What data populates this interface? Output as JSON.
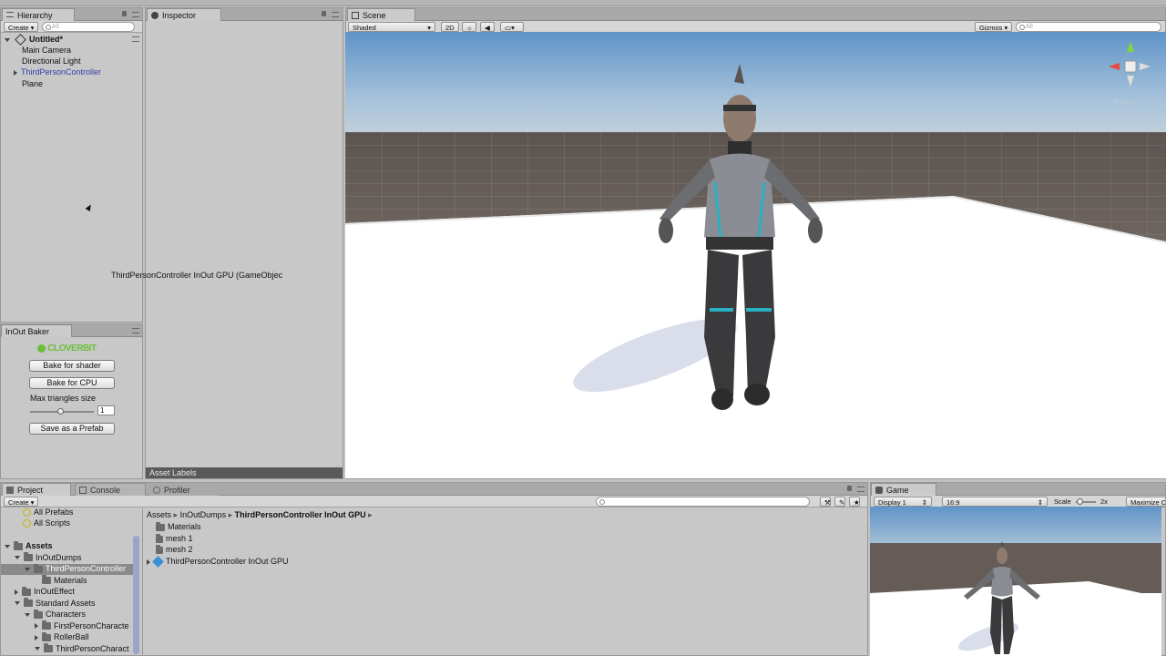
{
  "hierarchy": {
    "tab": "Hierarchy",
    "create_label": "Create",
    "search_placeholder": "All",
    "scene_name": "Untitled*",
    "items": [
      "Main Camera",
      "Directional Light",
      "ThirdPersonController",
      "Plane"
    ]
  },
  "inspector": {
    "tab": "Inspector",
    "drag_label": "ThirdPersonController InOut GPU (GameObjec",
    "asset_labels": "Asset Labels"
  },
  "baker": {
    "tab": "InOut Baker",
    "logo": "CLOVERBIT",
    "bake_shader": "Bake for shader",
    "bake_cpu": "Bake for CPU",
    "max_triangles_label": "Max triangles size",
    "max_triangles_value": "1",
    "save_prefab": "Save as a Prefab"
  },
  "scene": {
    "tab": "Scene",
    "shading": "Shaded",
    "mode_2d": "2D",
    "gizmos": "Gizmos",
    "search_placeholder": "All",
    "persp_label": "Persp"
  },
  "project": {
    "tabs": [
      "Project",
      "Console",
      "Profiler"
    ],
    "create_label": "Create",
    "favorites": [
      "All Prefabs",
      "All Scripts"
    ],
    "tree": [
      {
        "label": "Assets",
        "bold": true,
        "indent": 0,
        "arrow": "down"
      },
      {
        "label": "InOutDumps",
        "indent": 1,
        "arrow": "down"
      },
      {
        "label": "ThirdPersonController",
        "indent": 2,
        "arrow": "down",
        "selected": true
      },
      {
        "label": "Materials",
        "indent": 3,
        "arrow": ""
      },
      {
        "label": "InOutEffect",
        "indent": 1,
        "arrow": "right"
      },
      {
        "label": "Standard Assets",
        "indent": 1,
        "arrow": "down"
      },
      {
        "label": "Characters",
        "indent": 2,
        "arrow": "down"
      },
      {
        "label": "FirstPersonCharacte",
        "indent": 3,
        "arrow": "right"
      },
      {
        "label": "RollerBall",
        "indent": 3,
        "arrow": "right"
      },
      {
        "label": "ThirdPersonCharact",
        "indent": 3,
        "arrow": "down"
      }
    ],
    "breadcrumb": [
      "Assets",
      "InOutDumps",
      "ThirdPersonController InOut GPU"
    ],
    "files": [
      {
        "label": "Materials",
        "type": "folder"
      },
      {
        "label": "mesh 1",
        "type": "mesh"
      },
      {
        "label": "mesh 2",
        "type": "mesh"
      },
      {
        "label": "ThirdPersonController InOut GPU",
        "type": "prefab"
      }
    ]
  },
  "game": {
    "tab": "Game",
    "display": "Display 1",
    "aspect": "16:9",
    "scale_label": "Scale",
    "scale_value": "2x",
    "maximize": "Maximize C"
  }
}
